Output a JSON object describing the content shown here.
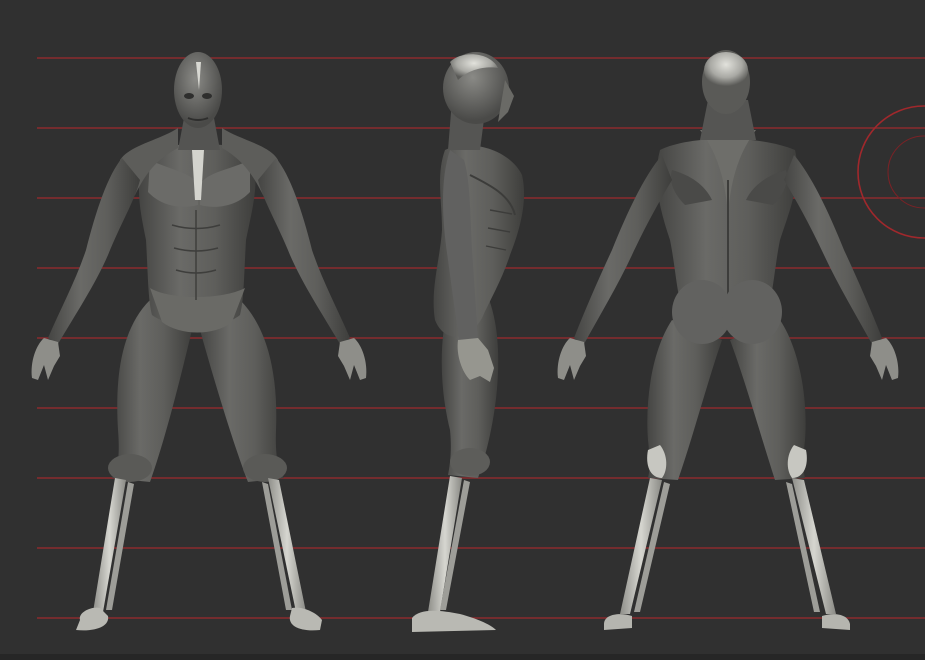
{
  "scene": {
    "kind": "3d-viewport",
    "views": [
      "front",
      "side",
      "back"
    ],
    "subject": "ecorche-anatomy-model",
    "guide_line_count": 9
  },
  "colors": {
    "background": "#303030",
    "guide_line": "#8a2a2e",
    "model_fill": "#5c5c5a",
    "model_shadow": "#3f3f3d",
    "model_highlight": "#8a8a86",
    "bone": "#c9c9c4",
    "bone_shadow": "#8f8f8a",
    "gizmo": "#a0282c"
  }
}
